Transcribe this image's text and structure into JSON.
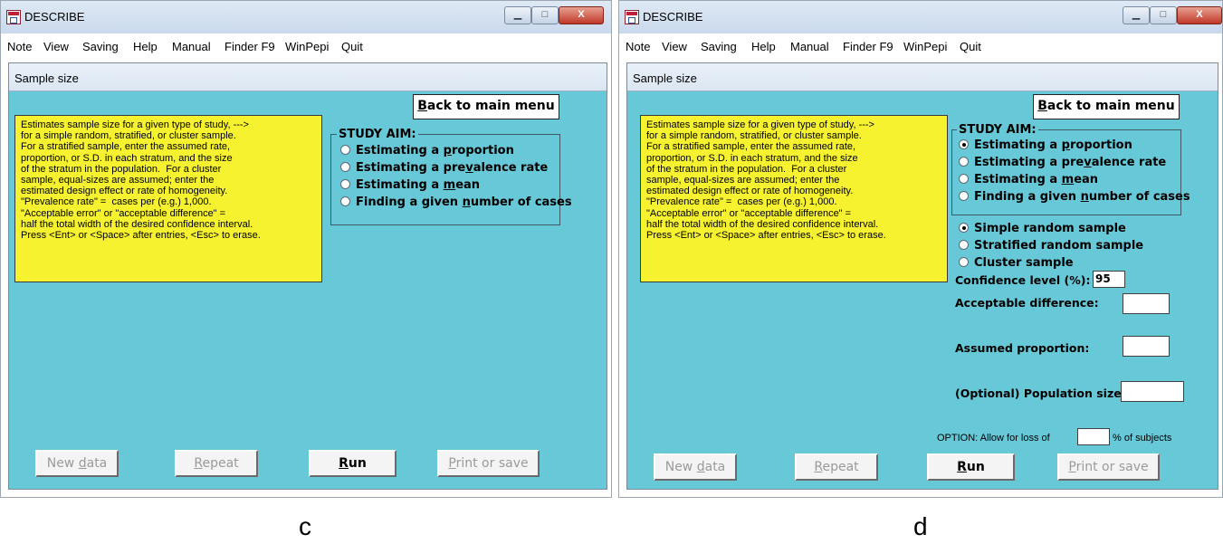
{
  "window_title": "DESCRIBE",
  "controls": {
    "minimize": "▁",
    "maximize": "□",
    "close": "X"
  },
  "menu": [
    "Note",
    "View",
    "Saving",
    "Help",
    "Manual",
    "Finder F9",
    "WinPepi",
    "Quit"
  ],
  "sub_title": "Sample size",
  "back_button": "Back to main menu",
  "info_text": "Estimates sample size for a given type of study, --->\nfor a simple random, stratified, or cluster sample.\nFor a stratified sample, enter the assumed rate,\nproportion, or S.D. in each stratum, and the size\nof the stratum in the population.  For a cluster\nsample, equal-sizes are assumed; enter the\nestimated design effect or rate of homogeneity.\n\"Prevalence rate\" =  cases per (e.g.) 1,000.\n\"Acceptable error\" or \"acceptable difference\" =\nhalf the total width of the desired confidence interval.\nPress <Ent> or <Space> after entries, <Esc> to erase.",
  "study_aim_title": "STUDY AIM:",
  "study_aim_options": [
    {
      "pre": "Estimating a ",
      "key": "p",
      "post": "roportion"
    },
    {
      "pre": "Estimating a pre",
      "key": "v",
      "post": "alence rate"
    },
    {
      "pre": "Estimating a ",
      "key": "m",
      "post": "ean"
    },
    {
      "pre": "Finding a given ",
      "key": "n",
      "post": "umber of cases"
    }
  ],
  "sample_types": [
    "Simple random sample",
    "Stratified random sample",
    "Cluster sample"
  ],
  "fields": {
    "confidence_label": "Confidence level (%):",
    "confidence_value": "95",
    "acceptable_difference_label": "Acceptable difference:",
    "assumed_proportion_label": "Assumed proportion:",
    "population_size_label": "(Optional) Population size:"
  },
  "option_line": {
    "pre": "OPTION:  Allow for loss of",
    "post": "% of subjects"
  },
  "buttons": {
    "new_data": {
      "pre": "New ",
      "key": "d",
      "post": "ata"
    },
    "repeat": {
      "pre": "",
      "key": "R",
      "post": "epeat"
    },
    "run": {
      "pre": "",
      "key": "R",
      "post": "un"
    },
    "print": {
      "pre": "",
      "key": "P",
      "post": "rint or save"
    }
  },
  "captions": {
    "left": "c",
    "right": "d"
  },
  "colors": {
    "panel": "#67c8d8",
    "info_box": "#f6f230",
    "selected_radio": "black"
  },
  "state": {
    "left": {
      "aim_selected": -1
    },
    "right": {
      "aim_selected": 0,
      "sample_selected": 0
    }
  }
}
